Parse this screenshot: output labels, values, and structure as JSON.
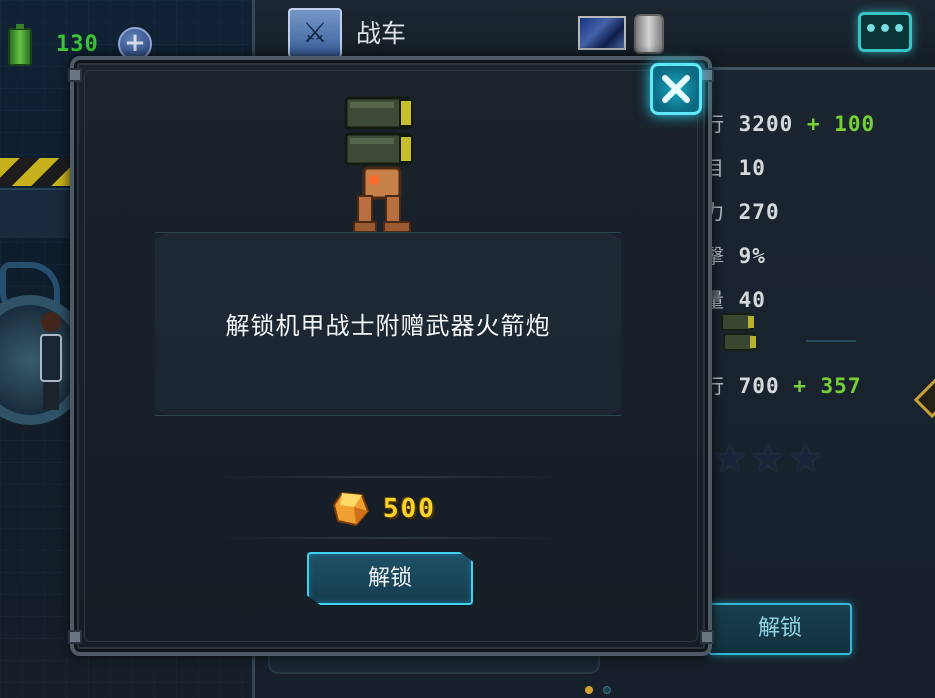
{
  "hud": {
    "energy": "130",
    "add_label": "+"
  },
  "panel": {
    "title": "战车",
    "chat_icon": "•••",
    "stats": [
      {
        "label": "行",
        "value": "3200",
        "bonus": "+ 100"
      },
      {
        "label": "目",
        "value": "10",
        "bonus": ""
      },
      {
        "label": "力",
        "value": "270",
        "bonus": ""
      },
      {
        "label": "擊",
        "value": "9%",
        "bonus": ""
      },
      {
        "label": "量",
        "value": "40",
        "bonus": ""
      },
      {
        "label": "行",
        "value": "700",
        "bonus": "+ 357"
      }
    ],
    "stars": "★★★",
    "unlock_label": "解锁"
  },
  "modal": {
    "description": "解锁机甲战士附赠武器火箭炮",
    "price": "500",
    "unlock_label": "解锁",
    "close_icon": "close-icon"
  },
  "pager": {
    "current": 1,
    "total": 2
  },
  "colors": {
    "accent_cyan": "#40d0f0",
    "price_gold": "#ffd42a",
    "bonus_green": "#7fe23a",
    "energy_green": "#44d63a"
  }
}
